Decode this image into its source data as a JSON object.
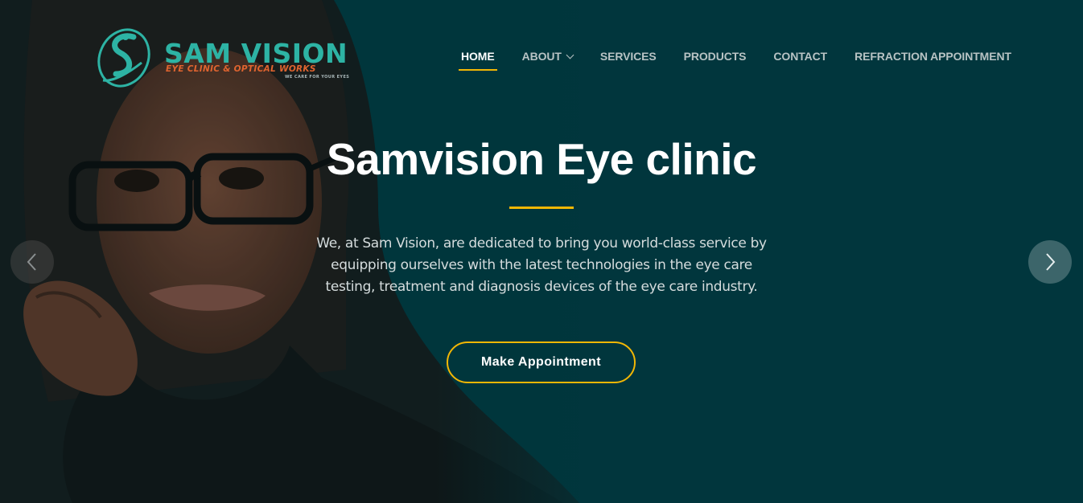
{
  "header": {
    "logo": {
      "name": "SAM VISION",
      "subtitle": "EYE CLINIC & OPTICAL WORKS",
      "tagline": "WE CARE FOR YOUR EYES",
      "colors": {
        "teal": "#2db3a4",
        "orange": "#e0642f"
      }
    },
    "nav": {
      "items": [
        {
          "label": "HOME",
          "active": true
        },
        {
          "label": "ABOUT",
          "has_dropdown": true,
          "icon": "chevron-down-icon"
        },
        {
          "label": "SERVICES"
        },
        {
          "label": "PRODUCTS"
        },
        {
          "label": "CONTACT"
        },
        {
          "label": "REFRACTION APPOINTMENT"
        }
      ]
    }
  },
  "hero": {
    "title": "Samvision Eye clinic",
    "description": "We, at Sam Vision, are dedicated to bring you world-class service by equipping ourselves with the latest technologies in the eye care testing, treatment and diagnosis devices of the eye care industry.",
    "cta_label": "Make Appointment",
    "prev_icon": "chevron-left-icon",
    "next_icon": "chevron-right-icon"
  },
  "colors": {
    "background": "#01363d",
    "accent": "#f2b705",
    "text": "#ffffff"
  }
}
